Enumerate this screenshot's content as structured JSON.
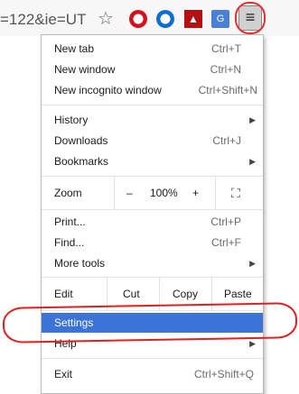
{
  "toolbar": {
    "url_fragment": "=122&ie=UT",
    "star": "☆",
    "ext_pdf": "▲",
    "ext_translate": "G",
    "menu_icon": "≡"
  },
  "menu": {
    "new_tab": {
      "label": "New tab",
      "shortcut": "Ctrl+T"
    },
    "new_window": {
      "label": "New window",
      "shortcut": "Ctrl+N"
    },
    "new_incognito": {
      "label": "New incognito window",
      "shortcut": "Ctrl+Shift+N"
    },
    "history": {
      "label": "History",
      "arrow": "▶"
    },
    "downloads": {
      "label": "Downloads",
      "shortcut": "Ctrl+J"
    },
    "bookmarks": {
      "label": "Bookmarks",
      "arrow": "▶"
    },
    "zoom": {
      "label": "Zoom",
      "minus": "–",
      "level": "100%",
      "plus": "+",
      "fullscreen": "⛶"
    },
    "print": {
      "label": "Print...",
      "shortcut": "Ctrl+P"
    },
    "find": {
      "label": "Find...",
      "shortcut": "Ctrl+F"
    },
    "more_tools": {
      "label": "More tools",
      "arrow": "▶"
    },
    "edit": {
      "label": "Edit",
      "cut": "Cut",
      "copy": "Copy",
      "paste": "Paste"
    },
    "settings": {
      "label": "Settings"
    },
    "help": {
      "label": "Help",
      "arrow": "▶"
    },
    "exit": {
      "label": "Exit",
      "shortcut": "Ctrl+Shift+Q"
    }
  },
  "colors": {
    "highlight": "#3b73d8",
    "annotation": "#e02020"
  }
}
